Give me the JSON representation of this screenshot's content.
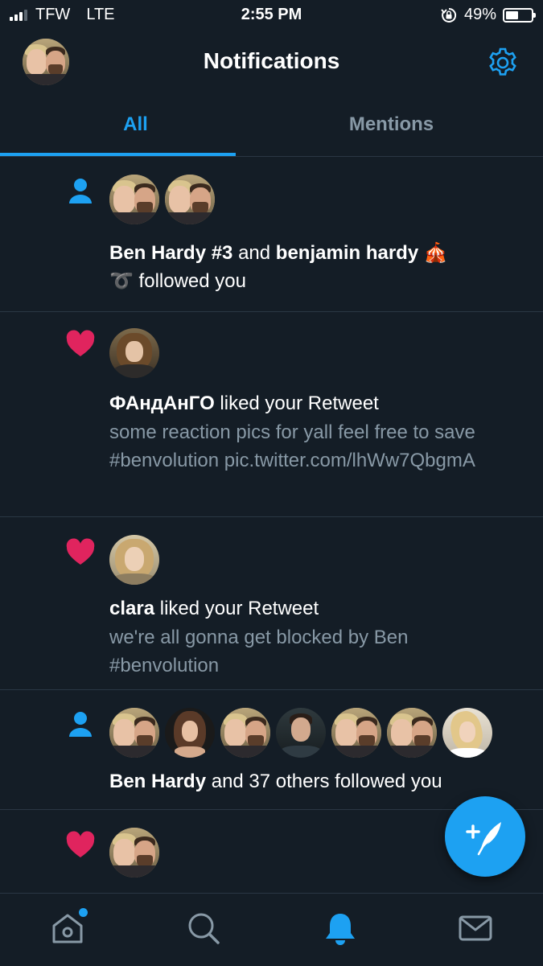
{
  "status_bar": {
    "carrier": "TFW",
    "network": "LTE",
    "time": "2:55 PM",
    "battery_percent": "49%",
    "battery_level": 0.49,
    "signal_bars": 3
  },
  "header": {
    "title": "Notifications",
    "settings_icon": "gear-icon"
  },
  "tabs": [
    {
      "label": "All",
      "selected": true
    },
    {
      "label": "Mentions",
      "selected": false
    }
  ],
  "notifications": [
    {
      "type": "follow",
      "icon": "person-icon",
      "actor1": "Ben Hardy #3",
      "connector": " and ",
      "actor2": "benjamin hardy 🎪",
      "line2": "➰ followed you"
    },
    {
      "type": "like",
      "icon": "heart-icon",
      "actor": "ФАндАнГО",
      "action": " liked your Retweet",
      "tweet_text": "some reaction pics for yall feel free to save #benvolution pic.twitter.com/lhWw7QbgmA"
    },
    {
      "type": "like",
      "icon": "heart-icon",
      "actor": "clara",
      "action": " liked your Retweet",
      "tweet_text": "we're all gonna get blocked by Ben #benvolution"
    },
    {
      "type": "follow",
      "icon": "person-icon",
      "actor": "Ben Hardy",
      "action": " and 37 others followed you"
    },
    {
      "type": "like",
      "icon": "heart-icon"
    }
  ],
  "colors": {
    "background": "#141d26",
    "accent": "#1da1f2",
    "heart": "#e0245e",
    "secondary_text": "#8899a6",
    "divider": "#2a3744"
  },
  "bottom_nav": [
    {
      "icon": "home-icon",
      "selected": false,
      "badge": true
    },
    {
      "icon": "search-icon",
      "selected": false
    },
    {
      "icon": "bell-icon",
      "selected": true
    },
    {
      "icon": "mail-icon",
      "selected": false
    }
  ],
  "fab_icon": "compose-tweet-icon"
}
